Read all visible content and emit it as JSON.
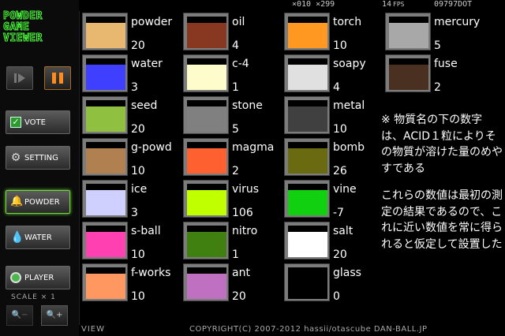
{
  "app": {
    "logo": "POWDER GAME VIEWER",
    "logo_lines": [
      "POWDER",
      "GAME",
      "VIEWER"
    ]
  },
  "status": {
    "scale_readout": "×010 ×299",
    "fps_value": "14",
    "fps_unit": "FPS",
    "dot_count": "09797DOT"
  },
  "sidebar": {
    "vote_label": "VOTE",
    "setting_label": "SETTING",
    "powder_label": "POWDER",
    "water_label": "WATER",
    "player_label": "PLAYER",
    "scale_label": "SCALE × 1",
    "zoom_out_label": "−",
    "zoom_in_label": "+"
  },
  "footer": {
    "view_label": "VIEW",
    "copyright": "COPYRIGHT(C) 2007-2012 hassii/otascube DAN-BALL.JP"
  },
  "elements": {
    "col1": [
      {
        "name": "powder",
        "value": "20",
        "color": "#e8b870"
      },
      {
        "name": "water",
        "value": "3",
        "color": "#3f3fff"
      },
      {
        "name": "seed",
        "value": "20",
        "color": "#8fc040"
      },
      {
        "name": "g-powd",
        "value": "10",
        "color": "#b08050"
      },
      {
        "name": "ice",
        "value": "3",
        "color": "#d0d0ff"
      },
      {
        "name": "s-ball",
        "value": "10",
        "color": "#ff40b0"
      },
      {
        "name": "f-works",
        "value": "10",
        "color": "#ff9860"
      }
    ],
    "col2": [
      {
        "name": "oil",
        "value": "4",
        "color": "#883820"
      },
      {
        "name": "c-4",
        "value": "1",
        "color": "#fffccc"
      },
      {
        "name": "stone",
        "value": "5",
        "color": "#808080"
      },
      {
        "name": "magma",
        "value": "2",
        "color": "#ff6030"
      },
      {
        "name": "virus",
        "value": "106",
        "color": "#c0ff00"
      },
      {
        "name": "nitro",
        "value": "1",
        "color": "#408010"
      },
      {
        "name": "ant",
        "value": "20",
        "color": "#c070c0"
      }
    ],
    "col3": [
      {
        "name": "torch",
        "value": "10",
        "color": "#ff9820"
      },
      {
        "name": "soapy",
        "value": "4",
        "color": "#e0e0e0"
      },
      {
        "name": "metal",
        "value": "10",
        "color": "#404040"
      },
      {
        "name": "bomb",
        "value": "26",
        "color": "#6a6a10"
      },
      {
        "name": "vine",
        "value": "-7",
        "color": "#10d010"
      },
      {
        "name": "salt",
        "value": "20",
        "color": "#ffffff"
      },
      {
        "name": "glass",
        "value": "0",
        "color": "#000000"
      }
    ],
    "col4": [
      {
        "name": "mercury",
        "value": "5",
        "color": "#a8a8a8"
      },
      {
        "name": "fuse",
        "value": "2",
        "color": "#4a3020"
      }
    ]
  },
  "note": {
    "para1": "※ 物質名の下の数字は、ACID１粒によりその物質が溶けた量のめやすである",
    "para2": "これらの数値は最初の測定の結果であるので、これに近い数値を常に得られると仮定して設置した"
  }
}
